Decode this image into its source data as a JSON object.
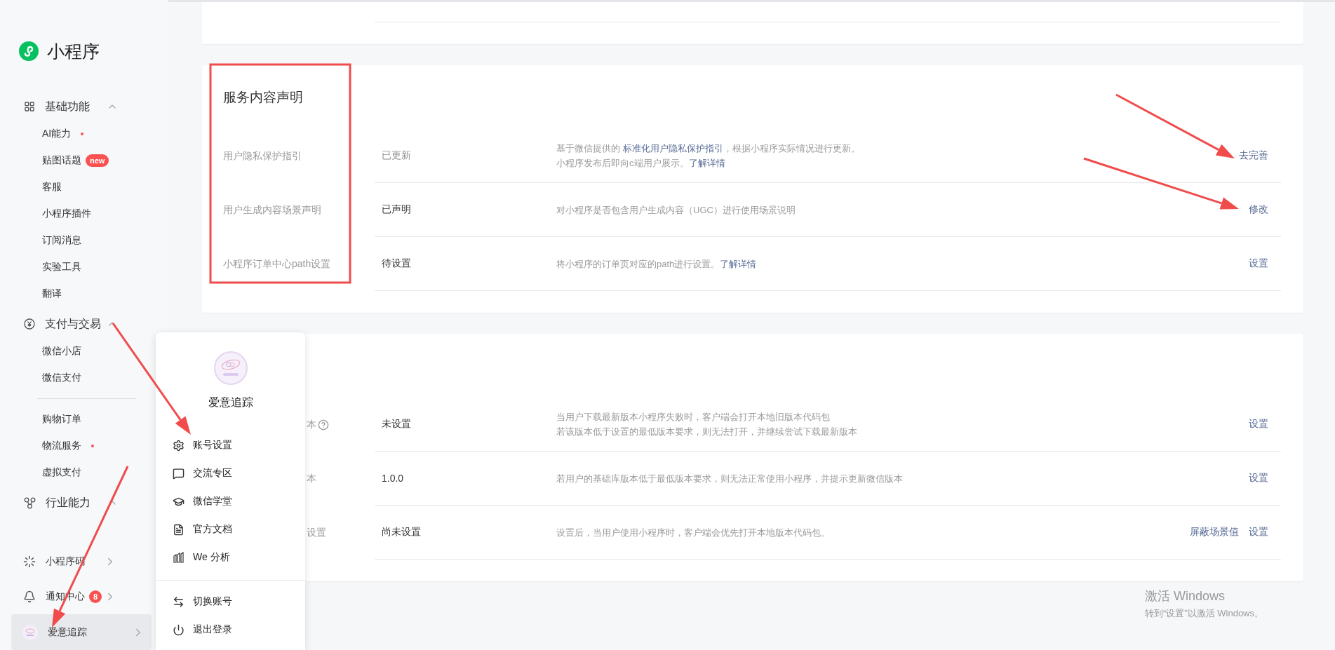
{
  "sidebar": {
    "title": "小程序",
    "groups": [
      {
        "label": "基础功能",
        "expanded": true,
        "sections": [
          [
            {
              "label": "AI能力",
              "dot": true
            },
            {
              "label": "贴图话题",
              "dot": false,
              "badge": "new"
            },
            {
              "label": "客服",
              "dot": false
            },
            {
              "label": "小程序插件",
              "dot": false
            },
            {
              "label": "订阅消息",
              "dot": false
            },
            {
              "label": "实验工具",
              "dot": false
            },
            {
              "label": "翻译",
              "dot": false
            }
          ]
        ]
      },
      {
        "label": "支付与交易",
        "expanded": true,
        "sections": [
          [
            {
              "label": "微信小店",
              "dot": false
            },
            {
              "label": "微信支付",
              "dot": false
            }
          ],
          [
            {
              "label": "购物订单",
              "dot": false
            },
            {
              "label": "物流服务",
              "dot": true
            },
            {
              "label": "虚拟支付",
              "dot": false
            }
          ]
        ]
      },
      {
        "label": "行业能力",
        "expanded": true
      }
    ],
    "links": [
      {
        "label": "小程序码"
      },
      {
        "label": "通知中心",
        "badge": "8"
      }
    ],
    "account": {
      "label": "爱意追踪",
      "selected": true
    }
  },
  "sections": [
    {
      "title": "服务内容声明",
      "rows": [
        {
          "label": "用户隐私保护指引",
          "help": false,
          "status": "已更新",
          "status_muted": true,
          "description": [
            [
              {
                "text": "基于微信提供的 ",
                "link": false
              },
              {
                "text": "标准化用户隐私保护指引",
                "link": true
              },
              {
                "text": "，根据小程序实际情况进行更新。",
                "link": false
              }
            ],
            [
              {
                "text": "小程序发布后即向c端用户展示。",
                "link": false
              },
              {
                "text": "了解详情",
                "link": true
              }
            ]
          ],
          "actions": [
            "去完善"
          ]
        },
        {
          "label": "用户生成内容场景声明",
          "help": false,
          "status": "已声明",
          "status_muted": false,
          "description": [
            [
              {
                "text": "对小程序是否包含用户生成内容（UGC）进行使用场景说明",
                "link": false
              }
            ]
          ],
          "actions": [
            "修改"
          ]
        },
        {
          "label": "小程序订单中心path设置",
          "help": false,
          "status": "待设置",
          "status_muted": false,
          "description": [
            [
              {
                "text": "将小程序的订单页对应的path进行设置。",
                "link": false
              },
              {
                "text": "了解详情",
                "link": true
              }
            ]
          ],
          "actions": [
            "设置"
          ]
        }
      ]
    },
    {
      "rows": [
        {
          "label": "本",
          "help": true,
          "status": "未设置",
          "status_muted": false,
          "description": [
            [
              {
                "text": "当用户下载最新版本小程序失败时，客户端会打开本地旧版本代码包",
                "link": false
              }
            ],
            [
              {
                "text": "若该版本低于设置的最低版本要求，则无法打开，并继续尝试下载最新版本",
                "link": false
              }
            ]
          ],
          "actions": [
            "设置"
          ]
        },
        {
          "label": "本",
          "help": false,
          "status": "1.0.0",
          "status_muted": false,
          "description": [
            [
              {
                "text": "若用户的基础库版本低于最低版本要求，则无法正常使用小程序，并提示更新微信版本",
                "link": false
              }
            ]
          ],
          "actions": [
            "设置"
          ]
        },
        {
          "label": "设置",
          "help": false,
          "status": "尚未设置",
          "status_muted": false,
          "description": [
            [
              {
                "text": "设置后，当用户使用小程序时，客户端会优先打开本地版本代码包。",
                "link": false
              }
            ]
          ],
          "actions": [
            "屏蔽场景值",
            "设置"
          ]
        }
      ]
    }
  ],
  "account_menu": {
    "name": "爱意追踪",
    "groups": [
      [
        "账号设置",
        "交流专区",
        "微信学堂",
        "官方文档",
        "We 分析"
      ],
      [
        "切换账号",
        "退出登录"
      ]
    ]
  },
  "activation_notice": {
    "title": "激活 Windows",
    "hint": "转到“设置”以激活 Windows。"
  }
}
